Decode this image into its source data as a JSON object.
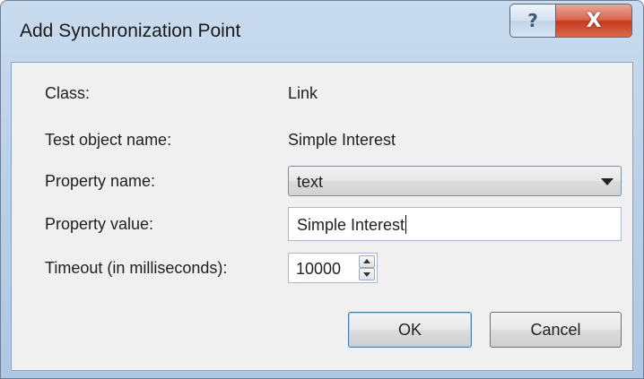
{
  "window": {
    "title": "Add Synchronization Point",
    "help_label": "?",
    "close_label": "X"
  },
  "form": {
    "class_label": "Class:",
    "class_value": "Link",
    "test_object_label": "Test object name:",
    "test_object_value": "Simple Interest",
    "property_name_label": "Property name:",
    "property_name_value": "text",
    "property_value_label": "Property value:",
    "property_value_value": "Simple Interest",
    "timeout_label": "Timeout (in milliseconds):",
    "timeout_value": "10000"
  },
  "buttons": {
    "ok_label": "OK",
    "cancel_label": "Cancel"
  },
  "icons": {
    "help": "help-icon",
    "close": "close-icon",
    "dropdown": "chevron-down-icon",
    "spin_up": "spin-up-icon",
    "spin_down": "spin-down-icon"
  },
  "colors": {
    "frame": "#b8cfe8",
    "close_button": "#c7381d",
    "client_bg": "#f0f0f0",
    "default_button_border": "#3c7fb1"
  }
}
